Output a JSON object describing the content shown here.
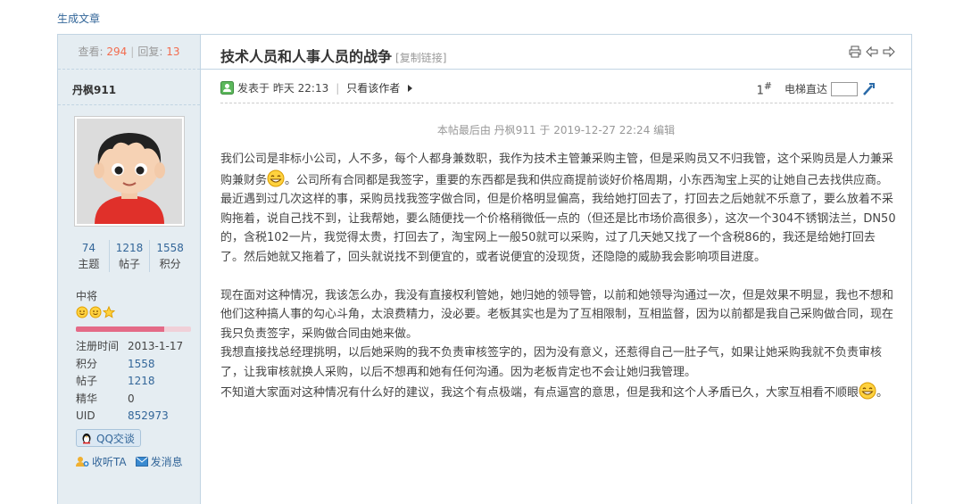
{
  "top_link": "生成文章",
  "sidebar": {
    "views_label": "查看:",
    "views": "294",
    "replies_label": "回复:",
    "replies": "13",
    "username": "丹枫911",
    "stats": [
      {
        "value": "74",
        "label": "主题"
      },
      {
        "value": "1218",
        "label": "帖子"
      },
      {
        "value": "1558",
        "label": "积分"
      }
    ],
    "rank": "中将",
    "rank_icons": [
      "sun-icon",
      "sun-icon",
      "star-icon"
    ],
    "rank_progress": 0.77,
    "info": [
      {
        "key": "注册时间",
        "value": "2013-1-17"
      },
      {
        "key": "积分",
        "value": "1558"
      },
      {
        "key": "帖子",
        "value": "1218"
      },
      {
        "key": "精华",
        "value": "0"
      },
      {
        "key": "UID",
        "value": "852973"
      }
    ],
    "qq_button": "QQ交谈",
    "follow_label": "收听TA",
    "message_label": "发消息"
  },
  "post": {
    "title": "技术人员和人事人员的战争",
    "copy_link": "[复制链接]",
    "posted_prefix": "发表于",
    "posted_time": "昨天 22:13",
    "author_only": "只看该作者",
    "floor_number": "1",
    "floor_suffix": "#",
    "elevator_label": "电梯直达",
    "edited_note": "本帖最后由 丹枫911 于 2019-12-27 22:24 编辑",
    "p1a": "我们公司是非标小公司，人不多，每个人都身兼数职，我作为技术主管兼采购主管，但是采购员又不归我管，这个采购员是人力兼采购兼财务",
    "p1b": "。公司所有合同都是我签字，重要的东西都是我和供应商提前谈好价格周期，小东西淘宝上买的让她自己去找供应商。",
    "p2": "最近遇到过几次这样的事，采购员找我签字做合同，但是价格明显偏高，我给她打回去了，打回去之后她就不乐意了，要么放着不采购拖着，说自己找不到，让我帮她，要么随便找一个价格稍微低一点的（但还是比市场价高很多），这次一个304不锈钢法兰，DN50的，含税102一片，我觉得太贵，打回去了，淘宝网上一般50就可以采购，过了几天她又找了一个含税86的，我还是给她打回去了。然后她就又拖着了，回头就说找不到便宜的，或者说便宜的没现货，还隐隐的威胁我会影响项目进度。",
    "p3": "现在面对这种情况，我该怎么办，我没有直接权利管她，她归她的领导管，以前和她领导沟通过一次，但是效果不明显，我也不想和他们这种搞人事的勾心斗角，太浪费精力，没必要。老板其实也是为了互相限制，互相监督，因为以前都是我自己采购做合同，现在我只负责签字，采购做合同由她来做。",
    "p4": "我想直接找总经理挑明，以后她采购的我不负责审核签字的，因为没有意义，还惹得自己一肚子气，如果让她采购我就不负责审核了，让我审核就换人采购，以后不想再和她有任何沟通。因为老板肯定也不会让她归我管理。",
    "p5a": "不知道大家面对这种情况有什么好的建议，我这个有点极端，有点逼宫的意思，但是我和这个人矛盾已久，大家互相看不顺眼",
    "p5b": "。"
  },
  "colors": {
    "link": "#336699",
    "highlight_number": "#f26c4f",
    "sidebar_bg": "#e5edf2",
    "border": "#c2d5e3"
  }
}
